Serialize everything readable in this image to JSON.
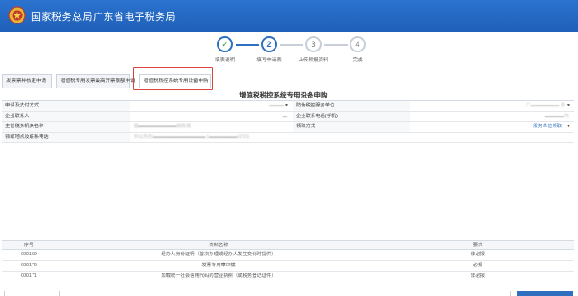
{
  "header": {
    "title": "国家税务总局广东省电子税务局"
  },
  "stepper": {
    "steps": [
      {
        "num": "✓",
        "label": "填表说明"
      },
      {
        "num": "2",
        "label": "填写申请表"
      },
      {
        "num": "3",
        "label": "上传附报资料"
      },
      {
        "num": "4",
        "label": "完成"
      }
    ]
  },
  "tabs": [
    "发票票种核定申请",
    "增值税专用发票最高开票限额申请",
    "增值税税控系统专用设备申购"
  ],
  "form": {
    "title": "增值税税控系统专用设备申购",
    "row1": {
      "label1": "申请及支付方式",
      "value1": "▬▬▬",
      "label2": "防伪税控服务单位",
      "value2": "广▬▬▬▬▬▬ 务"
    },
    "row2": {
      "label1": "企业联系人",
      "value1": "▬",
      "label2": "企业联系电话(手机)",
      "value2": "▬▬▬▬75"
    },
    "row3": {
      "label1": "主管税务机关名称",
      "value1": "国▬▬▬▬▬▬▬▬税务局",
      "label2": "领取方式",
      "value2": "服务单位领取"
    },
    "row4": {
      "label1": "领取地点及联系电话",
      "value1": "中山市石▬▬▬▬▬▬▬▬▬▬▬ (▬▬▬▬▬▬5219)"
    }
  },
  "table": {
    "headers": {
      "seq": "序号",
      "name": "资料名称",
      "req": "要求"
    },
    "rows": [
      {
        "seq": "000169",
        "name": "经办人身份证明（首次办理或经办人发生变化时提供）",
        "req": "非必报"
      },
      {
        "seq": "000170",
        "name": "发票专用章印模",
        "req": "必报"
      },
      {
        "seq": "000171",
        "name": "加载统一社会信用代码的营业执照（或税务登记证件）",
        "req": "非必报"
      }
    ]
  },
  "colors": {
    "header_bg": "#2b73cf",
    "accent": "#2e6fbf",
    "highlight": "#d9433b"
  }
}
